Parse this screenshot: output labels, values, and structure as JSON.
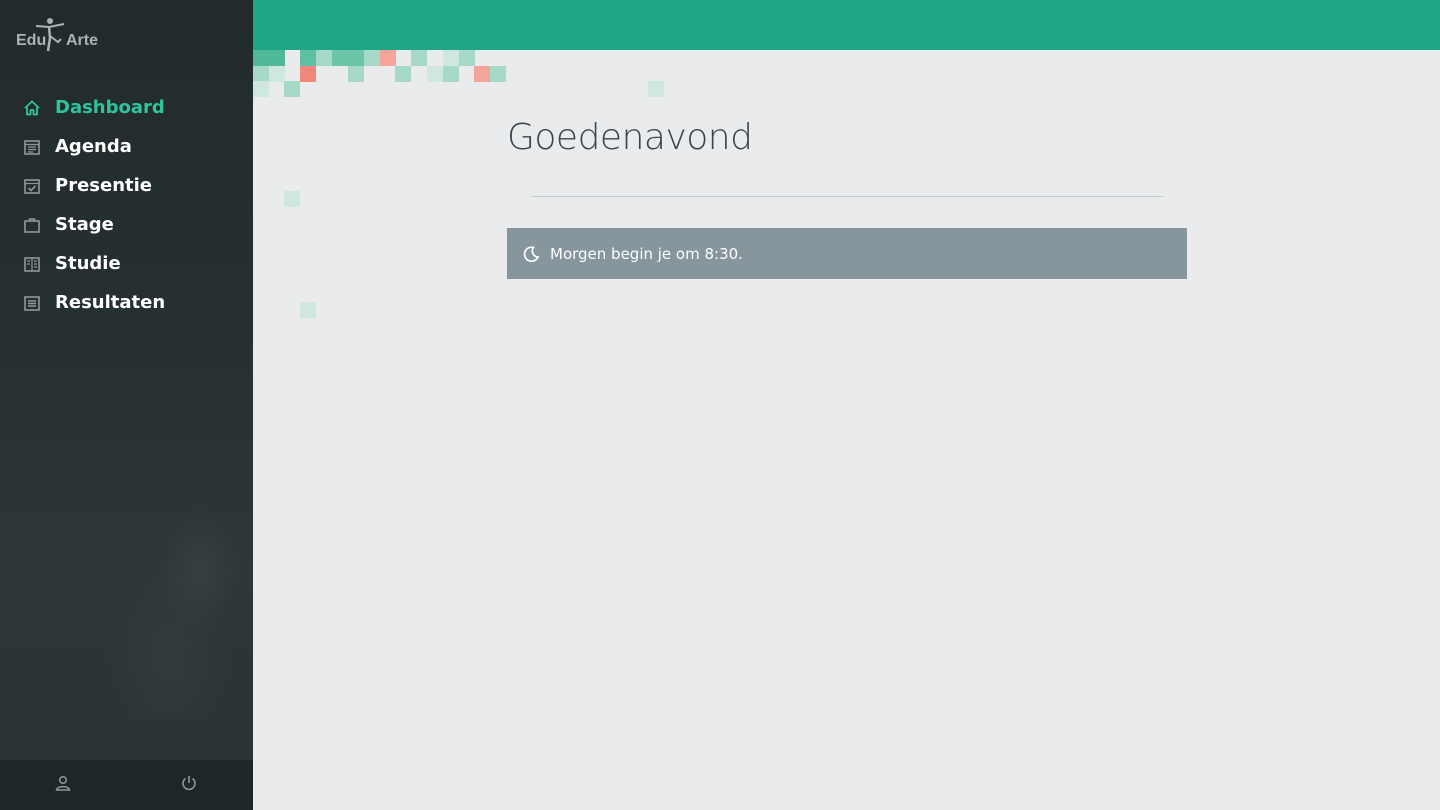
{
  "app": {
    "logo_left": "Edu",
    "logo_right": "Arte",
    "brand_color": "#1ea785",
    "active_color": "#2fc49a"
  },
  "sidebar": {
    "items": [
      {
        "label": "Dashboard",
        "icon": "home-icon",
        "active": true
      },
      {
        "label": "Agenda",
        "icon": "calendar-icon",
        "active": false
      },
      {
        "label": "Presentie",
        "icon": "calendar-check-icon",
        "active": false
      },
      {
        "label": "Stage",
        "icon": "briefcase-icon",
        "active": false
      },
      {
        "label": "Studie",
        "icon": "book-icon",
        "active": false
      },
      {
        "label": "Resultaten",
        "icon": "list-icon",
        "active": false
      }
    ],
    "footer": {
      "profile_icon": "user-icon",
      "logout_icon": "power-icon"
    }
  },
  "main": {
    "greeting": "Goedenavond",
    "notice": {
      "icon": "moon-icon",
      "text": "Morgen begin je om 8:30."
    }
  }
}
